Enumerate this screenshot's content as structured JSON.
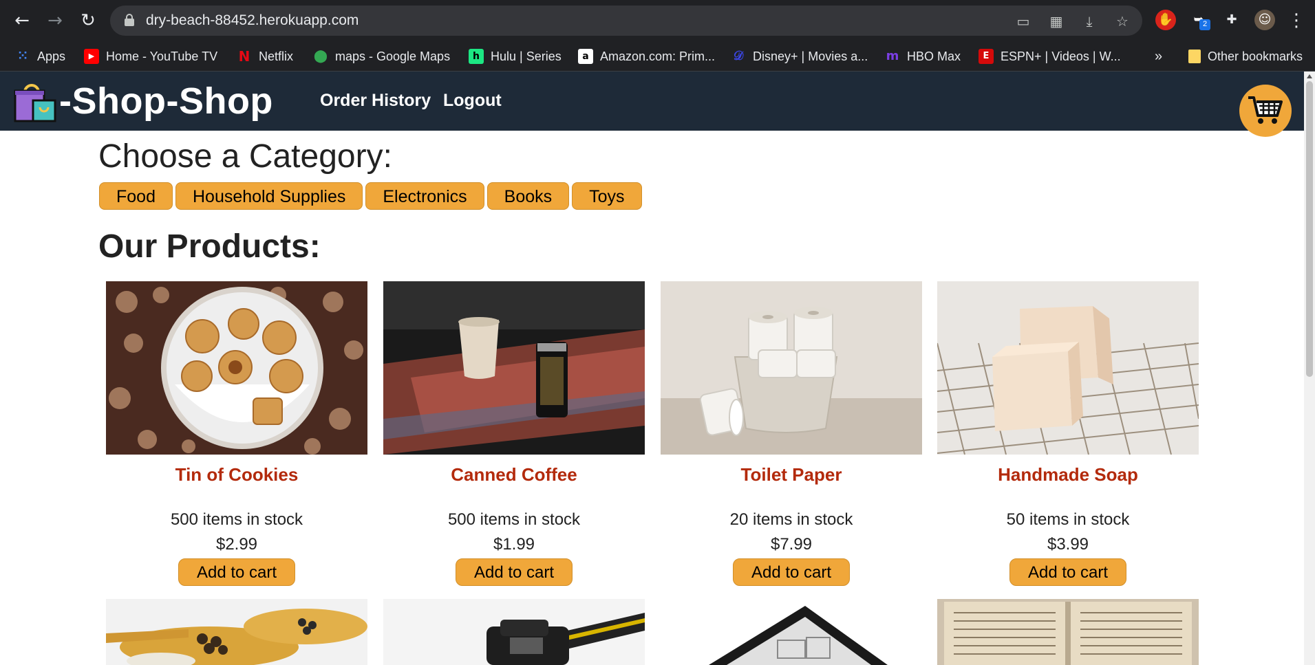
{
  "browser": {
    "url": "dry-beach-88452.herokuapp.com",
    "extension_badge": "2",
    "bookmarks": [
      {
        "label": "Apps",
        "icon": "apps-grid-icon"
      },
      {
        "label": "Home - YouTube TV",
        "icon": "youtube-icon"
      },
      {
        "label": "Netflix",
        "icon": "netflix-icon"
      },
      {
        "label": "maps - Google Maps",
        "icon": "maps-pin-icon"
      },
      {
        "label": "Hulu | Series",
        "icon": "hulu-icon"
      },
      {
        "label": "Amazon.com: Prim...",
        "icon": "amazon-icon"
      },
      {
        "label": "Disney+ | Movies a...",
        "icon": "disney-icon"
      },
      {
        "label": "HBO Max",
        "icon": "hbo-icon"
      },
      {
        "label": "ESPN+ | Videos | W...",
        "icon": "espn-icon"
      }
    ],
    "overflow_label": "»",
    "other_bookmarks": "Other bookmarks"
  },
  "header": {
    "logo_text": "-Shop-Shop",
    "nav": [
      "Order History",
      "Logout"
    ]
  },
  "categories": {
    "heading": "Choose a Category:",
    "items": [
      "Food",
      "Household Supplies",
      "Electronics",
      "Books",
      "Toys"
    ]
  },
  "products": {
    "heading": "Our Products:",
    "items": [
      {
        "name": "Tin of Cookies",
        "stock": "500 items in stock",
        "price": "$2.99",
        "button": "Add to cart"
      },
      {
        "name": "Canned Coffee",
        "stock": "500 items in stock",
        "price": "$1.99",
        "button": "Add to cart"
      },
      {
        "name": "Toilet Paper",
        "stock": "20 items in stock",
        "price": "$7.99",
        "button": "Add to cart"
      },
      {
        "name": "Handmade Soap",
        "stock": "50 items in stock",
        "price": "$3.99",
        "button": "Add to cart"
      }
    ]
  },
  "colors": {
    "header_bg": "#1e2a38",
    "accent": "#f0a73a",
    "product_name": "#b32a0c"
  }
}
